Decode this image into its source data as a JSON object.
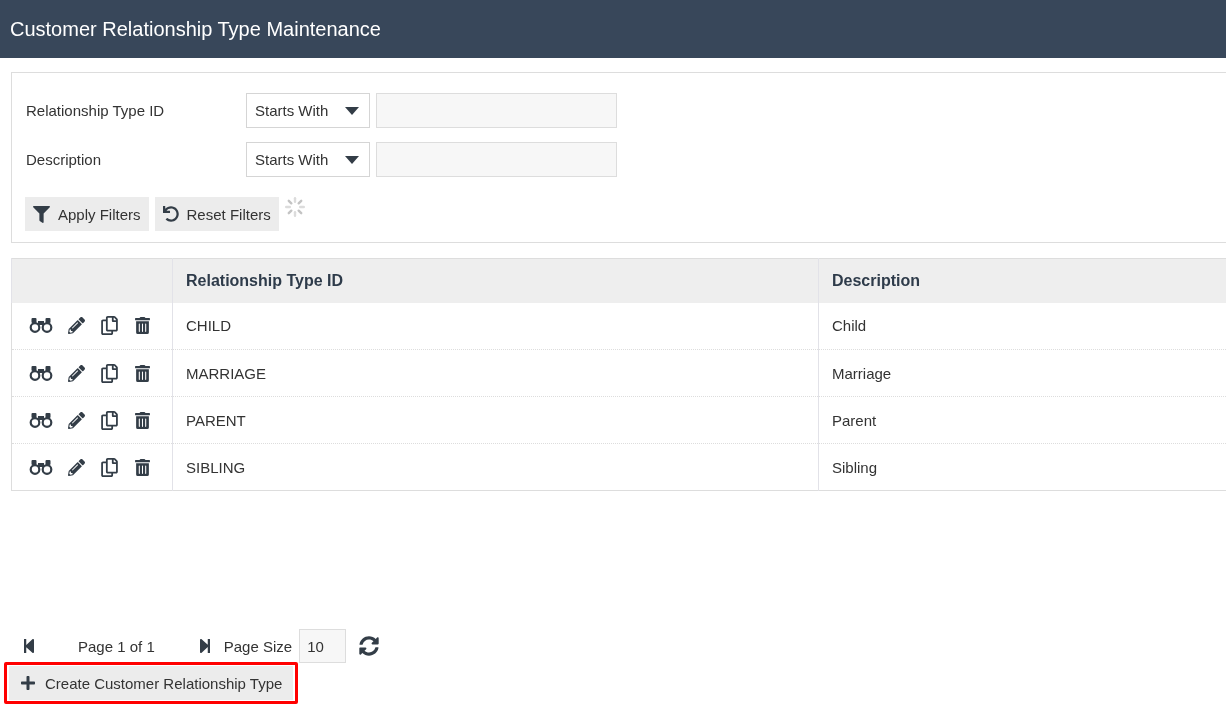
{
  "header": {
    "title": "Customer Relationship Type Maintenance"
  },
  "filters": {
    "fields": [
      {
        "label": "Relationship Type ID",
        "operator": "Starts With"
      },
      {
        "label": "Description",
        "operator": "Starts With"
      }
    ],
    "buttons": [
      {
        "kind": "apply",
        "label": "Apply Filters"
      },
      {
        "kind": "reset",
        "label": "Reset Filters"
      }
    ],
    "loading": true
  },
  "table": {
    "columns": [
      "Relationship Type ID",
      "Description"
    ],
    "rows": [
      {
        "cells": [
          "CHILD",
          "Child"
        ]
      },
      {
        "cells": [
          "MARRIAGE",
          "Marriage"
        ]
      },
      {
        "cells": [
          "PARENT",
          "Parent"
        ]
      },
      {
        "cells": [
          "SIBLING",
          "Sibling"
        ]
      }
    ]
  },
  "pagination": {
    "page_label": "Page 1 of 1",
    "page_size_label": "Page Size",
    "page_size": "10"
  },
  "create_button": {
    "label": "Create Customer Relationship Type",
    "highlighted": true
  }
}
